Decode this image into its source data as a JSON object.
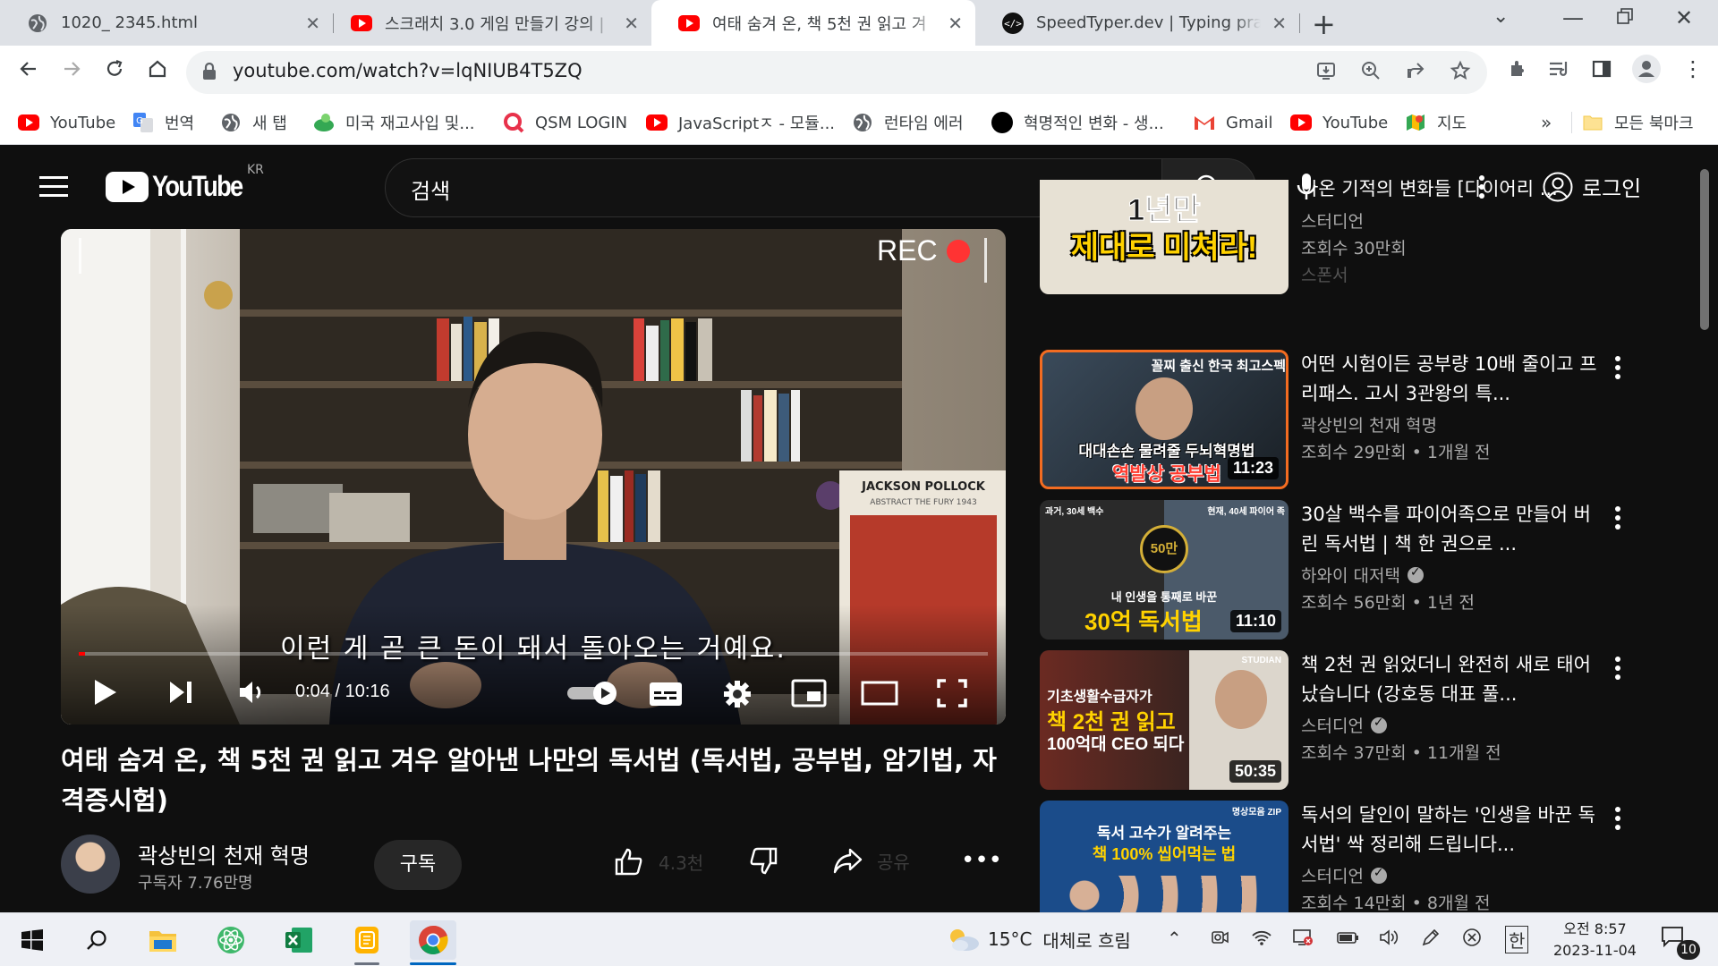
{
  "browser": {
    "tabs": [
      {
        "title": "1020_ 2345.html",
        "icon": "globe-icon"
      },
      {
        "title": "스크래치 3.0 게임 만들기 강의 |",
        "icon": "youtube-icon"
      },
      {
        "title": "여태 숨겨 온, 책 5천 권 읽고 겨",
        "icon": "youtube-icon",
        "active": true
      },
      {
        "title": "SpeedTyper.dev | Typing practice",
        "icon": "code-icon"
      }
    ],
    "url": "youtube.com/watch?v=lqNIUB4T5ZQ",
    "bookmarks": [
      {
        "label": "YouTube",
        "icon": "youtube-icon"
      },
      {
        "label": "번역",
        "icon": "translate-icon"
      },
      {
        "label": "새 탭",
        "icon": "globe-icon"
      },
      {
        "label": "미국 재고사입 및...",
        "icon": "leaf-icon"
      },
      {
        "label": "QSM LOGIN",
        "icon": "q-icon"
      },
      {
        "label": "JavaScriptㅈ - 모듈...",
        "icon": "youtube-icon"
      },
      {
        "label": "런타임 에러",
        "icon": "globe-icon"
      },
      {
        "label": "혁명적인 변화 - 생...",
        "icon": "black-circle-icon"
      },
      {
        "label": "Gmail",
        "icon": "gmail-icon"
      },
      {
        "label": "YouTube",
        "icon": "youtube-icon"
      },
      {
        "label": "지도",
        "icon": "maps-icon"
      }
    ],
    "bookmarks_overflow": "»",
    "all_bookmarks": "모든 북마크"
  },
  "youtube": {
    "logo_word": "YouTube",
    "country_code": "KR",
    "search_placeholder": "검색",
    "login_label": "로그인",
    "player": {
      "rec_label": "REC",
      "subtitle": "이런 게 곧 큰 돈이 돼서 돌아오는 거예요.",
      "current_time": "0:04",
      "duration": "10:16",
      "time_display": "0:04 / 10:16",
      "progress": 0.0065,
      "poster_text": "JACKSON POLLOCK",
      "poster_sub": "ABSTRACT THE FURY 1943"
    },
    "video_title": "여태 숨겨 온, 책 5천 권 읽고 겨우 알아낸 나만의 독서법 (독서법, 공부법, 암기법, 자격증시험)",
    "channel_name": "곽상빈의 천재 혁명",
    "subscriber_count": "구독자 7.76만명",
    "subscribe_label": "구독",
    "like_count": "4.3천",
    "share_label": "공유",
    "recommendations": [
      {
        "title": "아온 기적의 변화들 [다이어리 ...",
        "channel": "스터디언",
        "views": "조회수 30만회",
        "age": "",
        "extra": "스폰서",
        "duration": "",
        "thumb_caption_1": "1년만",
        "thumb_caption_2": "제대로 미쳐라!",
        "verified": false
      },
      {
        "title": "어떤 시험이든 공부량 10배 줄이고 프리패스. 고시 3관왕의 특...",
        "channel": "곽상빈의 천재 혁명",
        "views": "조회수 29만회",
        "age": "1개월 전",
        "duration": "11:23",
        "thumb_caption_1": "꼴찌 출신 한국 최고스펙",
        "thumb_caption_2": "대대손손 물려줄 두뇌혁명법",
        "thumb_caption_3": "역발상 공부법",
        "verified": false
      },
      {
        "title": "30살 백수를 파이어족으로 만들어 버린 독서법 | 책 한 권으로 ...",
        "channel": "하와이 대저택",
        "views": "조회수 56만회",
        "age": "1년 전",
        "duration": "11:10",
        "thumb_caption_1": "과거, 30세 백수",
        "thumb_caption_4": "현재, 40세 파이어 족",
        "thumb_caption_5": "50만",
        "thumb_caption_2": "내 인생을 통째로 바꾼",
        "thumb_caption_3": "30억 독서법",
        "verified": true
      },
      {
        "title": "책 2천 권 읽었더니 완전히 새로 태어났습니다 (강호동 대표 풀...",
        "channel": "스터디언",
        "views": "조회수 37만회",
        "age": "11개월 전",
        "duration": "50:35",
        "thumb_caption_4": "STUDIAN",
        "thumb_caption_1": "기초생활수급자가",
        "thumb_caption_2": "책 2천 권 읽고",
        "thumb_caption_3": "100억대 CEO 되다",
        "verified": true
      },
      {
        "title": "독서의 달인이 말하는 '인생을 바꾼 독서법' 싹 정리해 드립니다...",
        "channel": "스터디언",
        "views": "조회수 14만회",
        "age": "8개월 전",
        "duration": "",
        "thumb_caption_4": "명상모음 ZIP",
        "thumb_caption_1": "독서 고수가 알려주는",
        "thumb_caption_2": "책 100% 씹어먹는 법",
        "verified": true
      }
    ]
  },
  "taskbar": {
    "weather_temp": "15°C",
    "weather_desc": "대체로 흐림",
    "ime": "한",
    "time": "오전 8:57",
    "date": "2023-11-04",
    "notification_count": "10"
  },
  "colors": {
    "youtube_red": "#ff0000",
    "yt_bg": "#0f0f0f",
    "chrome_tabstrip": "#dee1e6",
    "taskbar": "#eef0f5"
  }
}
